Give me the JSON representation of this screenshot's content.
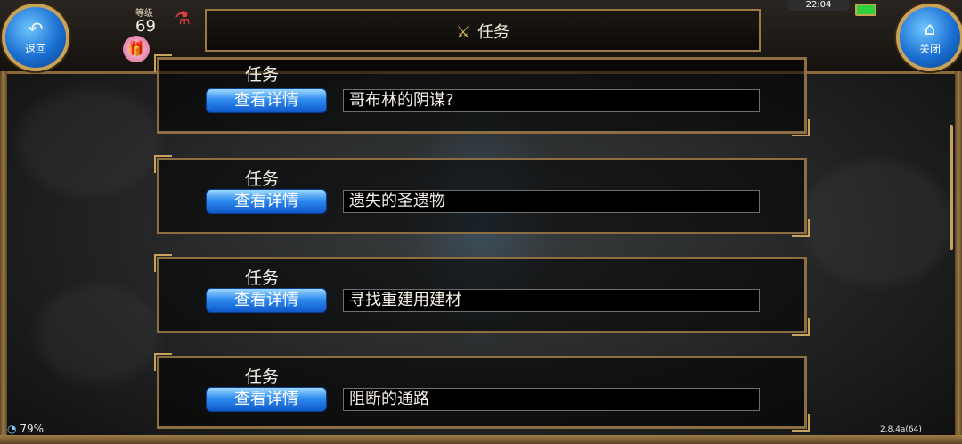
{
  "header": {
    "back_label": "返回",
    "close_label": "关闭",
    "title": "任务",
    "level_label": "等级",
    "level_value": "69",
    "clock": "22:04"
  },
  "quests": [
    {
      "heading": "任务",
      "button": "查看详情",
      "name": "哥布林的阴谋?"
    },
    {
      "heading": "任务",
      "button": "查看详情",
      "name": "遗失的圣遗物"
    },
    {
      "heading": "任务",
      "button": "查看详情",
      "name": "寻找重建用建材"
    },
    {
      "heading": "任务",
      "button": "查看详情",
      "name": "阻断的通路"
    }
  ],
  "footer": {
    "signal": "79%",
    "version": "2.8.4a(64)"
  },
  "icons": {
    "back": "back-arrow-icon",
    "close": "home-icon",
    "title": "crossed-swords-icon",
    "gift": "gift-icon",
    "potion": "potion-icon"
  }
}
